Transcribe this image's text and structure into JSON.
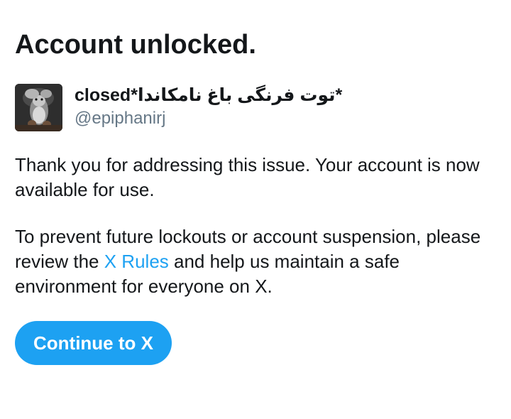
{
  "heading": "Account unlocked.",
  "account": {
    "avatar_icon": "squirrel-avatar",
    "display_name": "closed*توت فرنگی باغ نامکاندا*",
    "handle": "@epiphanirj"
  },
  "message": {
    "paragraph1": "Thank you for addressing this issue. Your account is now available for use.",
    "paragraph2_before": "To prevent future lockouts or account suspension, please review the ",
    "rules_link": "X Rules",
    "paragraph2_after": " and help us maintain a safe environment for everyone on X."
  },
  "continue_button": "Continue to X",
  "colors": {
    "accent": "#1da1f2",
    "text": "#14171a",
    "muted": "#657786"
  }
}
